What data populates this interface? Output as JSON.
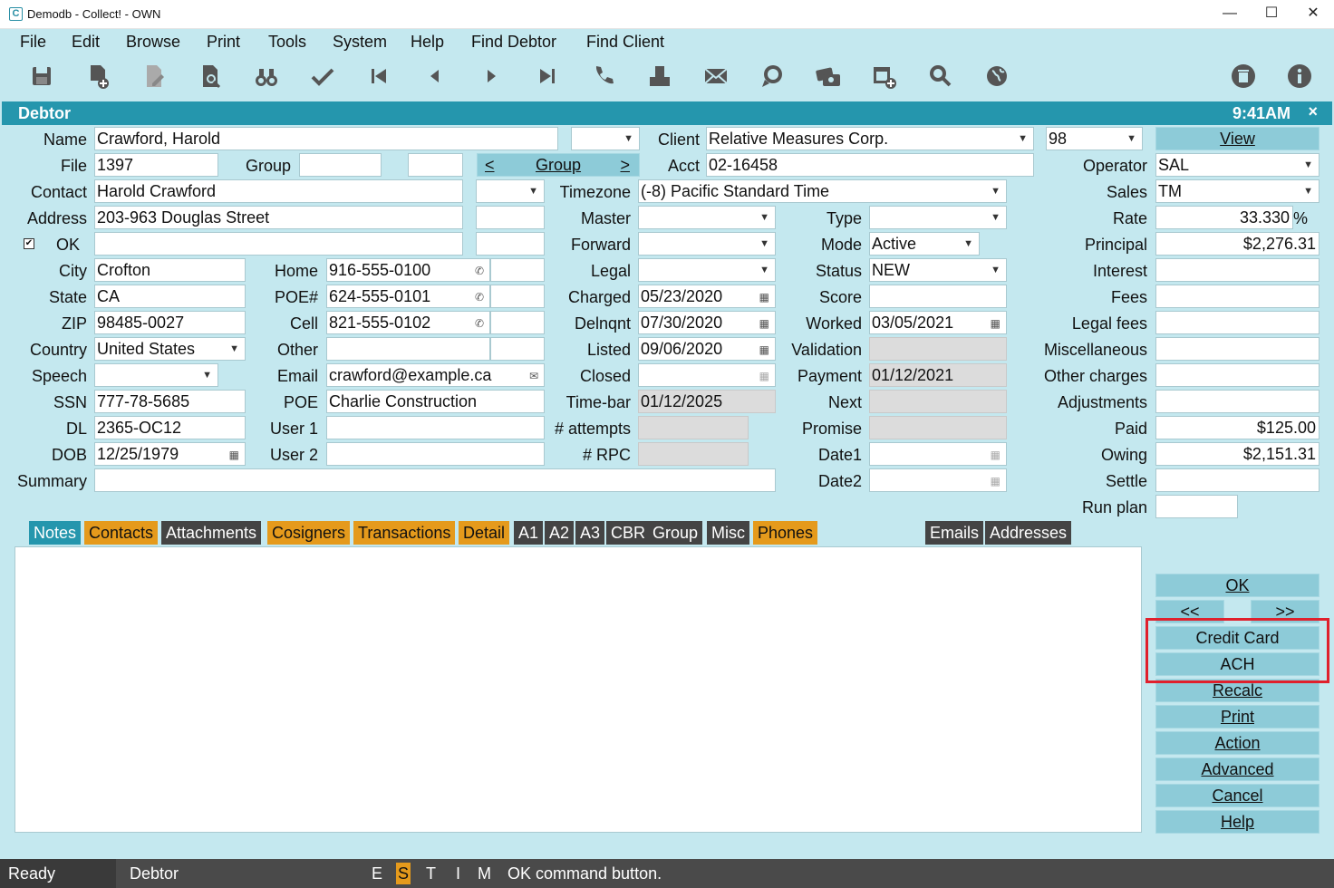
{
  "window": {
    "title": "Demodb - Collect! - OWN",
    "app_icon": "C"
  },
  "menu": [
    "File",
    "Edit",
    "Browse",
    "Print",
    "Tools",
    "System",
    "Help",
    "Find Debtor",
    "Find Client"
  ],
  "toolbar_icons": [
    "save-icon",
    "new-document-icon",
    "edit-document-icon",
    "search-document-icon",
    "binoculars-icon",
    "checkmark-icon",
    "first-record-icon",
    "previous-record-icon",
    "next-record-icon",
    "last-record-icon",
    "phone-icon",
    "print-icon",
    "email-icon",
    "chat-icon",
    "payment-card-icon",
    "schedule-icon",
    "search-icon",
    "globe-icon",
    "delete-icon",
    "info-icon"
  ],
  "header": {
    "title": "Debtor",
    "time": "9:41AM",
    "close": "×"
  },
  "labels": {
    "name": "Name",
    "file": "File",
    "group": "Group",
    "contact": "Contact",
    "address": "Address",
    "ok": "OK",
    "city": "City",
    "state": "State",
    "zip": "ZIP",
    "country": "Country",
    "speech": "Speech",
    "ssn": "SSN",
    "dl": "DL",
    "dob": "DOB",
    "summary": "Summary",
    "home": "Home",
    "poe_num": "POE#",
    "cell": "Cell",
    "other": "Other",
    "email": "Email",
    "poe": "POE",
    "user1": "User 1",
    "user2": "User 2",
    "client": "Client",
    "acct": "Acct",
    "timezone": "Timezone",
    "master": "Master",
    "forward": "Forward",
    "legal": "Legal",
    "charged": "Charged",
    "delnqnt": "Delnqnt",
    "listed": "Listed",
    "closed": "Closed",
    "timebar": "Time-bar",
    "attempts": "# attempts",
    "rpc": "# RPC",
    "type": "Type",
    "mode": "Mode",
    "status": "Status",
    "score": "Score",
    "worked": "Worked",
    "validation": "Validation",
    "payment": "Payment",
    "next": "Next",
    "promise": "Promise",
    "date1": "Date1",
    "date2": "Date2",
    "operator": "Operator",
    "sales": "Sales",
    "rate": "Rate",
    "principal": "Principal",
    "interest": "Interest",
    "fees": "Fees",
    "legal_fees": "Legal fees",
    "misc": "Miscellaneous",
    "other_charges": "Other charges",
    "adjustments": "Adjustments",
    "paid": "Paid",
    "owing": "Owing",
    "settle": "Settle",
    "run_plan": "Run plan",
    "percent": "%"
  },
  "values": {
    "name": "Crawford, Harold",
    "file": "1397",
    "contact": "Harold Crawford",
    "address": "203-963 Douglas Street",
    "city": "Crofton",
    "state": "CA",
    "zip": "98485-0027",
    "country": "United States",
    "ssn": "777-78-5685",
    "dl": "2365-OC12",
    "dob": "12/25/1979",
    "home": "916-555-0100",
    "poe_num": "624-555-0101",
    "cell": "821-555-0102",
    "email": "crawford@example.ca",
    "poe": "Charlie Construction",
    "client": "Relative Measures Corp.",
    "client_num": "98",
    "acct": "02-16458",
    "timezone": "(-8) Pacific Standard Time",
    "charged": "05/23/2020",
    "delnqnt": "07/30/2020",
    "listed": "09/06/2020",
    "timebar": "01/12/2025",
    "mode": "Active",
    "status": "NEW",
    "worked": "03/05/2021",
    "payment": "01/12/2021",
    "operator": "SAL",
    "sales": "TM",
    "rate": "33.330",
    "principal": "$2,276.31",
    "paid": "$125.00",
    "owing": "$2,151.31"
  },
  "group_nav": {
    "prev": "<",
    "label": "Group",
    "next": ">"
  },
  "buttons": {
    "view": "View",
    "ok": "OK",
    "prev": "<<",
    "next": ">>",
    "credit_card": "Credit Card",
    "ach": "ACH",
    "recalc": "Recalc",
    "print": "Print",
    "action": "Action",
    "advanced": "Advanced",
    "cancel": "Cancel",
    "help": "Help"
  },
  "tabs": [
    "Notes",
    "Contacts",
    "Attachments",
    "Cosigners",
    "Transactions",
    "Detail",
    "A1",
    "A2",
    "A3",
    "CBR",
    "Group",
    "Misc",
    "Phones",
    "Emails",
    "Addresses"
  ],
  "status": {
    "ready": "Ready",
    "form": "Debtor",
    "flags": [
      "E",
      "S",
      "T",
      "I",
      "M"
    ],
    "message": "OK command button."
  },
  "colors": {
    "accent": "#2596ad",
    "orange_tab": "#e59a1c",
    "dark_tab": "#444444",
    "background": "#c4e8ef",
    "highlight": "#e0202c"
  }
}
